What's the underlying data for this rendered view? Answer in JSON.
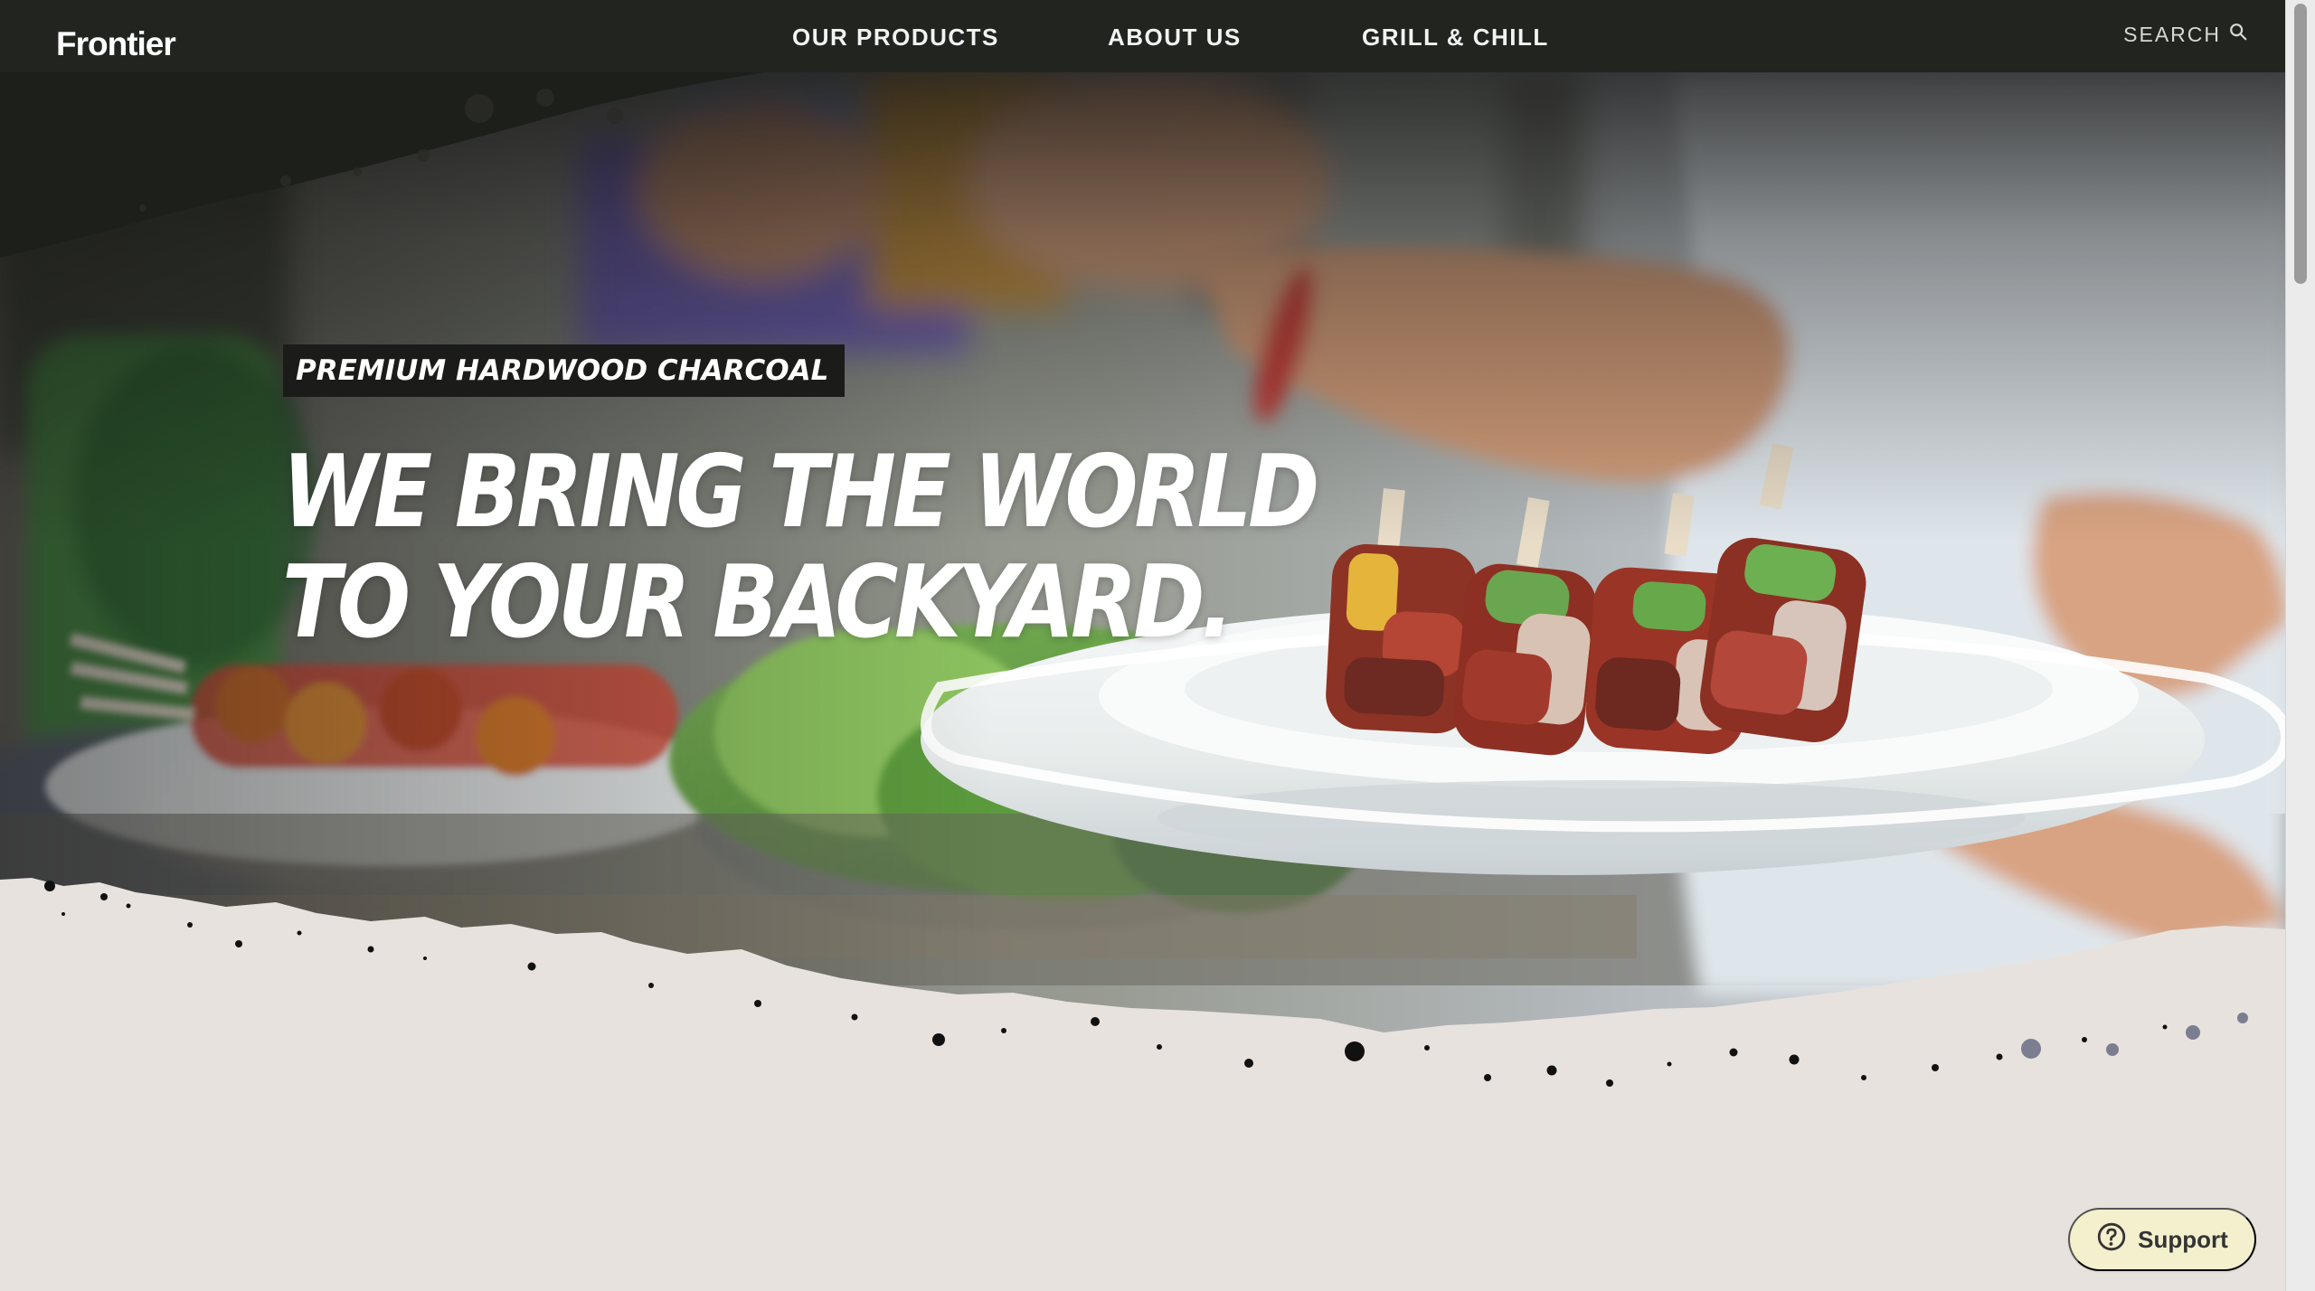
{
  "brand": {
    "logo": "Frontier"
  },
  "nav": {
    "items": [
      {
        "label": "OUR PRODUCTS"
      },
      {
        "label": "ABOUT US"
      },
      {
        "label": "GRILL & CHILL"
      }
    ],
    "search_label": "SEARCH",
    "search_icon": "search-icon"
  },
  "hero": {
    "tag": "PREMIUM HARDWOOD CHARCOAL",
    "headline_line1": "WE BRING THE WORLD",
    "headline_line2": "TO YOUR BACKYARD."
  },
  "support": {
    "label": "Support",
    "icon": "help-circle-icon"
  },
  "colors": {
    "nav_bg": "#22241f",
    "page_bg": "#e7e2dd",
    "tag_bg": "#1b1b1a",
    "support_bg": "#f4efcd"
  }
}
